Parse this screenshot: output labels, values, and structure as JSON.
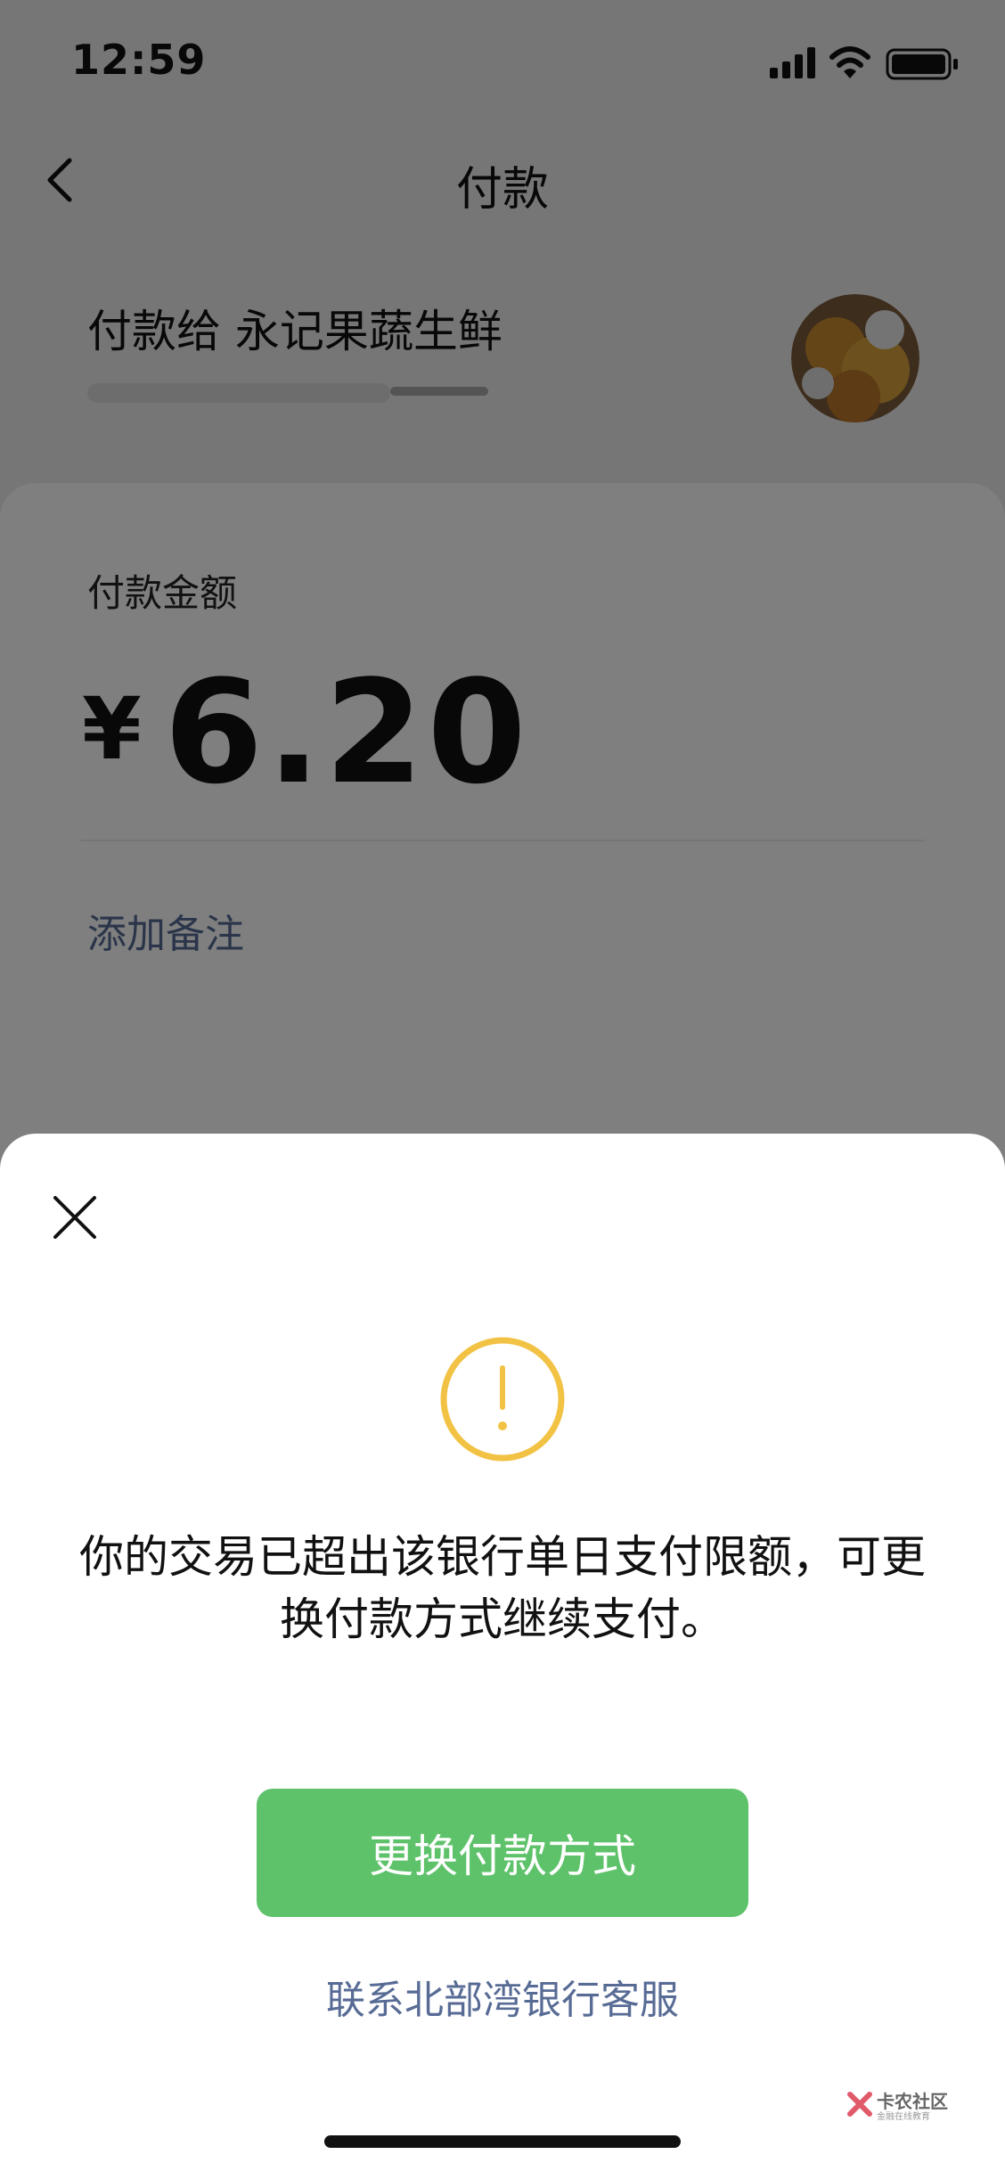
{
  "status_bar": {
    "time": "12:59"
  },
  "nav": {
    "title": "付款"
  },
  "payee": {
    "label": "付款给 永记果蔬生鲜"
  },
  "amount": {
    "label": "付款金额",
    "currency": "¥",
    "value": "6.20"
  },
  "remark": {
    "label": "添加备注"
  },
  "dialog": {
    "message": "你的交易已超出该银行单日支付限额，可更换付款方式继续支付。",
    "primary_button": "更换付款方式",
    "secondary_link": "联系北部湾银行客服"
  },
  "watermark": {
    "name": "卡农社区",
    "sub": "金融在线教育"
  },
  "colors": {
    "accent_green": "#5ec26a",
    "link_blue": "#576b95",
    "warning_yellow": "#f2c244"
  }
}
